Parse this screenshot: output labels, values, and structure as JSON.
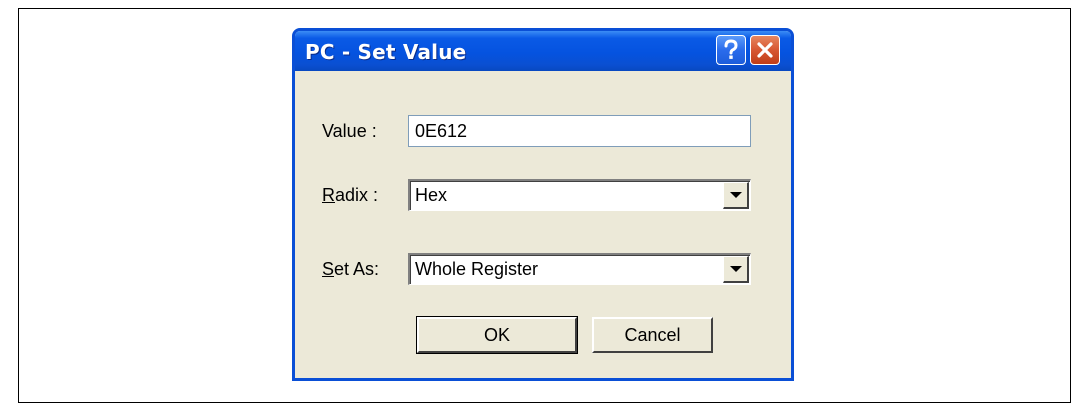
{
  "dialog": {
    "title": "PC - Set Value",
    "help_icon": "question-mark-icon",
    "close_icon": "close-x-icon",
    "title_color": "#0553e0",
    "close_color": "#d75732"
  },
  "fields": {
    "value": {
      "label": "Value :",
      "text": "0E612"
    },
    "radix": {
      "label_underlined": "R",
      "label_rest": "adix :",
      "selected": "Hex"
    },
    "set_as": {
      "label_underlined": "S",
      "label_rest": "et As:",
      "selected": "Whole Register"
    }
  },
  "buttons": {
    "ok": "OK",
    "cancel": "Cancel"
  }
}
